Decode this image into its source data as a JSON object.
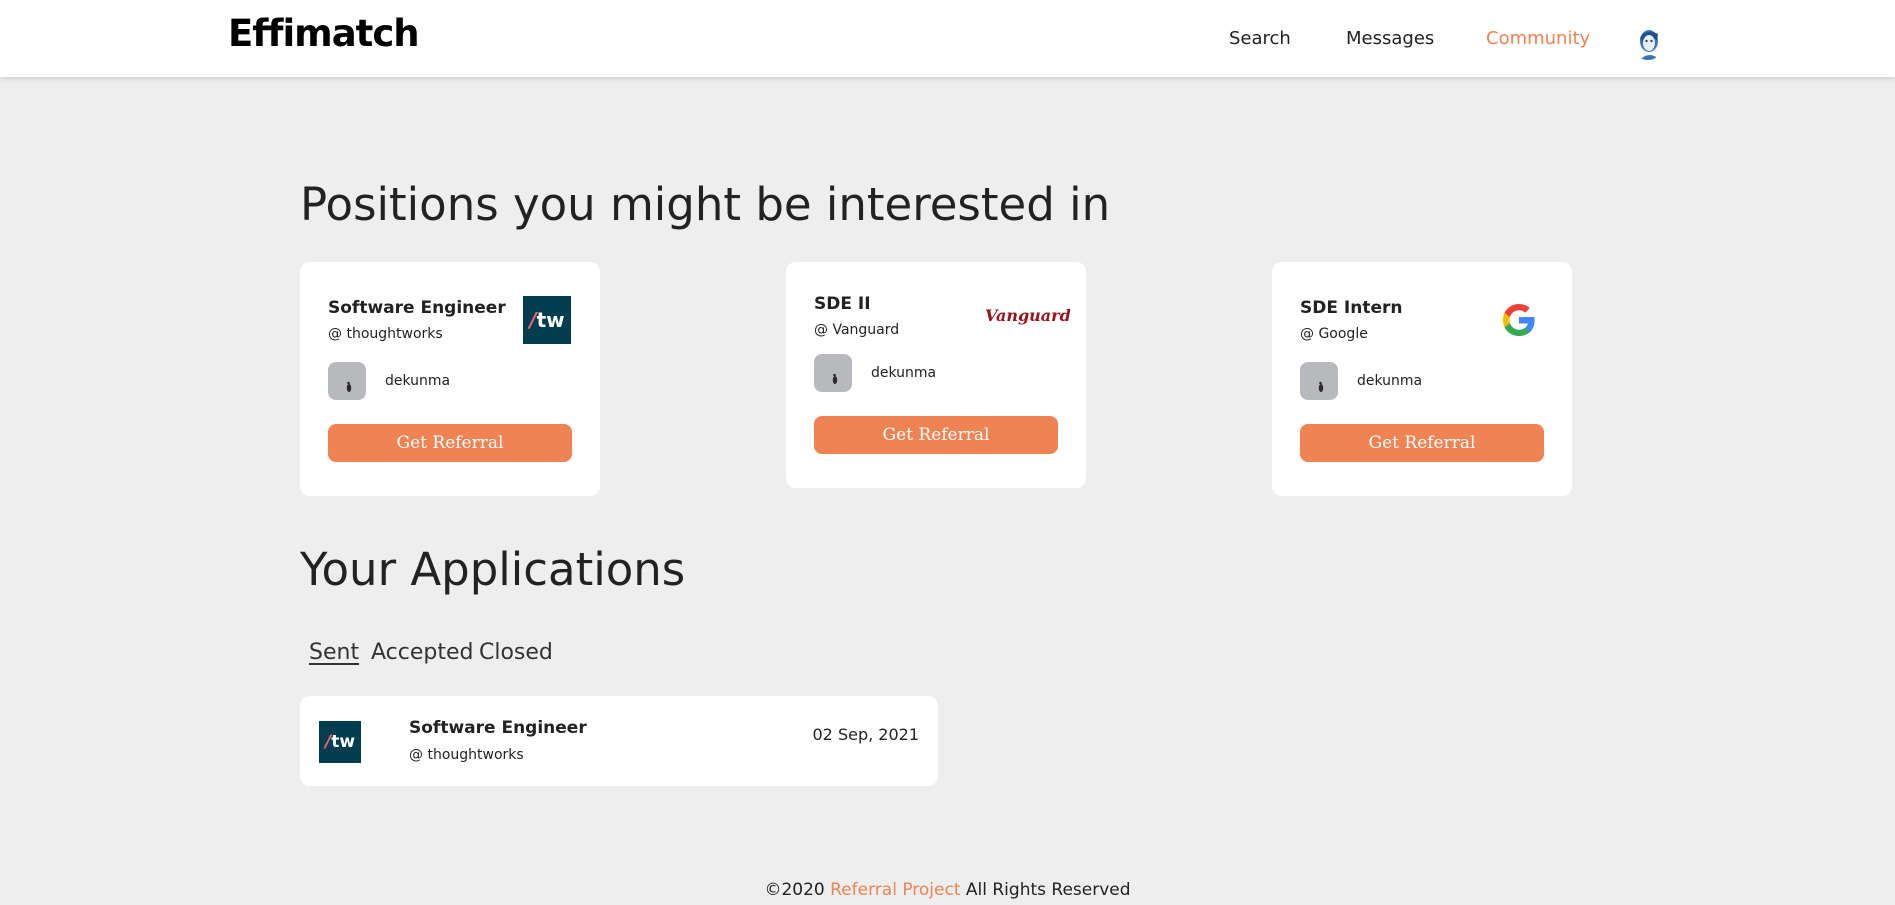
{
  "header": {
    "brand": "Effimatch",
    "nav": {
      "search": "Search",
      "messages": "Messages",
      "community": "Community"
    },
    "accent_color": "#ef8354"
  },
  "positions": {
    "heading": "Positions you might be interested in",
    "cards": [
      {
        "title": "Software Engineer",
        "company": "@ thoughtworks",
        "logo_text": "tw",
        "referrer": "dekunma",
        "button": "Get Referral"
      },
      {
        "title": "SDE II",
        "company": "@ Vanguard",
        "logo_text": "Vanguard",
        "referrer": "dekunma",
        "button": "Get Referral"
      },
      {
        "title": "SDE Intern",
        "company": "@ Google",
        "logo_text": "",
        "referrer": "dekunma",
        "button": "Get Referral"
      }
    ]
  },
  "applications": {
    "heading": "Your Applications",
    "tabs": [
      "Sent",
      "Accepted",
      "Closed"
    ],
    "active_tab": "Sent",
    "items": [
      {
        "title": "Software Engineer",
        "company": "@ thoughtworks",
        "logo_text": "tw",
        "date": "02 Sep, 2021"
      }
    ]
  },
  "footer": {
    "prefix": "©2020",
    "link": "Referral Project",
    "suffix": "All Rights Reserved"
  },
  "icons": {
    "user_avatar": "person-avatar-icon",
    "referrer_avatar": "person-silhouette-icon",
    "google": "google-g-icon"
  }
}
